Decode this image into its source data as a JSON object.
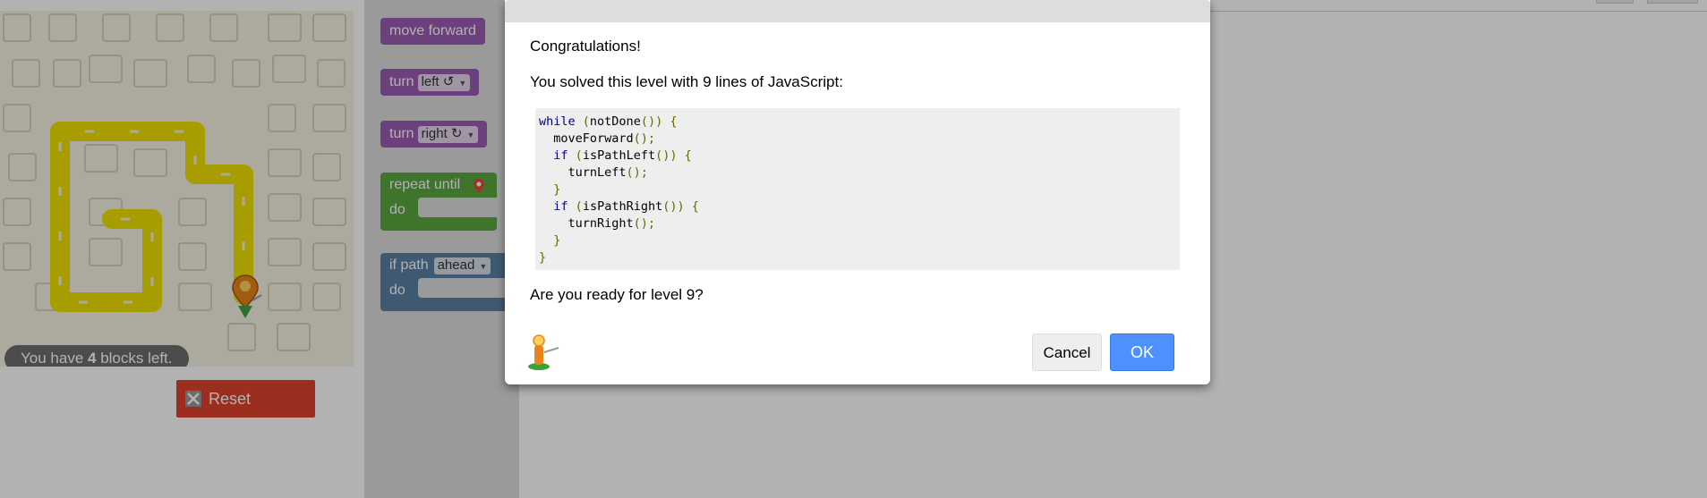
{
  "maze": {
    "blocks_left_prefix": "You have ",
    "blocks_left_count": "4",
    "blocks_left_suffix": " blocks left."
  },
  "reset": {
    "label": "Reset"
  },
  "toolbox": {
    "move_forward": "move forward",
    "turn_left": {
      "label": "turn",
      "dir": "left ↺"
    },
    "turn_right": {
      "label": "turn",
      "dir": "right ↻"
    },
    "repeat_until": {
      "label": "repeat until",
      "do": "do"
    },
    "if_path": {
      "label": "if path",
      "dir": "ahead",
      "do": "do"
    }
  },
  "dialog": {
    "title": "Congratulations!",
    "message": "You solved this level with 9 lines of JavaScript:",
    "code_lines": [
      "while (notDone()) {",
      "  moveForward();",
      "  if (isPathLeft()) {",
      "    turnLeft();",
      "  }",
      "  if (isPathRight()) {",
      "    turnRight();",
      "  }",
      "}"
    ],
    "question": "Are you ready for level 9?",
    "cancel_label": "Cancel",
    "ok_label": "OK"
  },
  "colors": {
    "path": "#f0e100",
    "ok_button": "#4d90fe",
    "reset_button": "#e0432f",
    "block_purple": "#9a5cb4",
    "block_green": "#5aa640",
    "block_blue": "#5b80a5",
    "overlay": "rgba(0,0,0,0.3)"
  },
  "icons": {
    "pegman": "pegman-icon",
    "finish": "map-marker-icon",
    "reset": "close-icon"
  }
}
